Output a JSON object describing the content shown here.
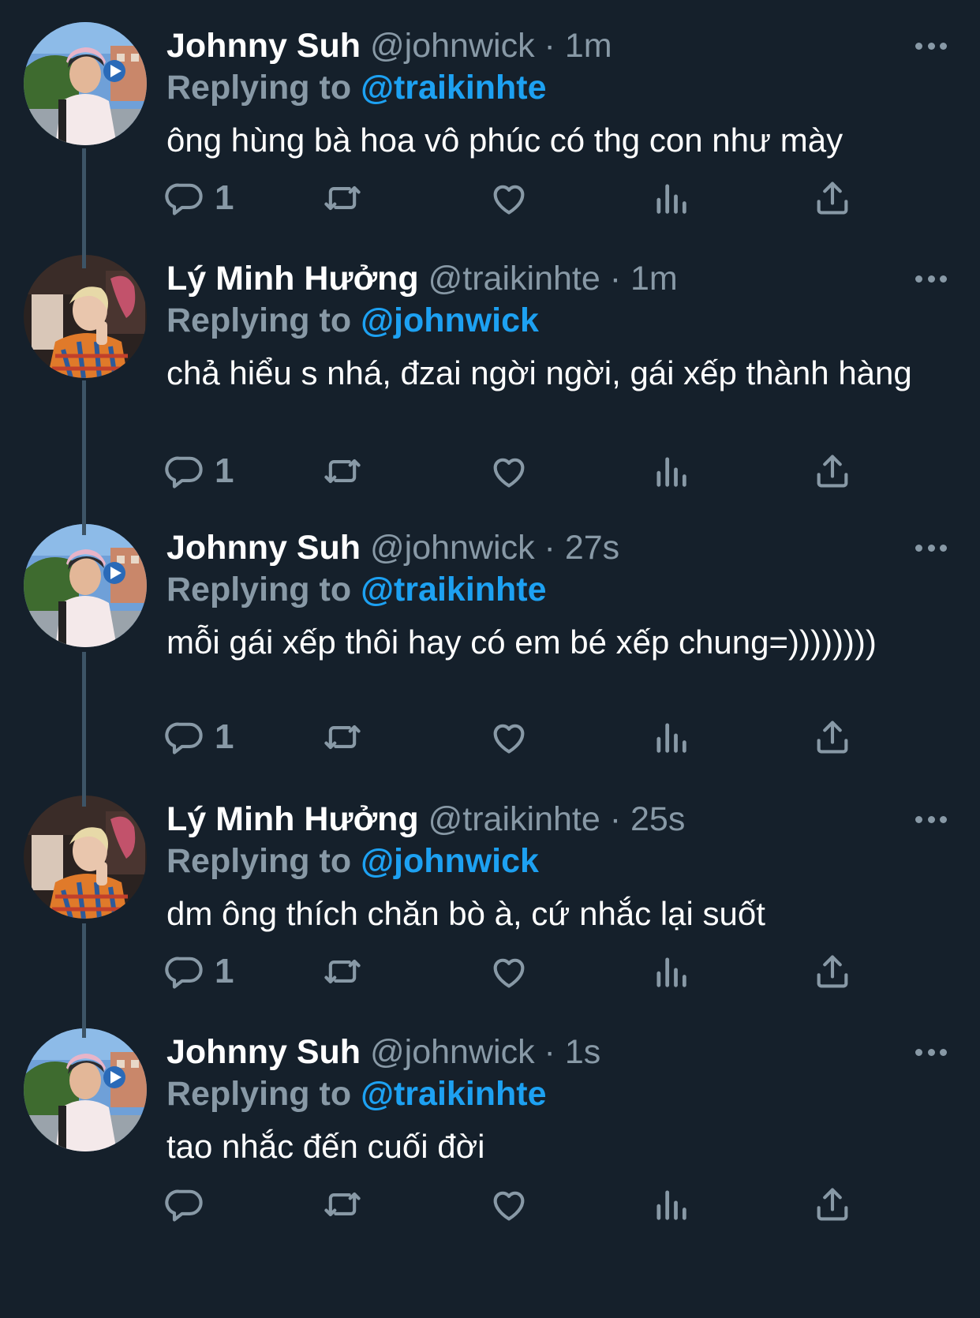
{
  "tweets": [
    {
      "author": "Johnny Suh",
      "handle": "@johnwick",
      "sep": "·",
      "time": "1m",
      "replying_label": "Replying to",
      "replying_to": "@traikinhte",
      "text": "ông hùng bà hoa vô phúc có thg con như mày",
      "reply_count": "1",
      "avatar": "johnny"
    },
    {
      "author": "Lý Minh Hưởng",
      "handle": "@traikinhte",
      "sep": "·",
      "time": "1m",
      "replying_label": "Replying to",
      "replying_to": "@johnwick",
      "text": "chả hiểu s nhá, đzai ngời ngời, gái xếp thành hàng",
      "reply_count": "1",
      "avatar": "ly"
    },
    {
      "author": "Johnny Suh",
      "handle": "@johnwick",
      "sep": "·",
      "time": "27s",
      "replying_label": "Replying to",
      "replying_to": "@traikinhte",
      "text": "mỗi gái xếp thôi hay có em bé xếp chung=))))))))",
      "reply_count": "1",
      "avatar": "johnny"
    },
    {
      "author": "Lý Minh Hưởng",
      "handle": "@traikinhte",
      "sep": "·",
      "time": "25s",
      "replying_label": "Replying to",
      "replying_to": "@johnwick",
      "text": "dm ông thích chăn bò à, cứ nhắc lại suốt",
      "reply_count": "1",
      "avatar": "ly"
    },
    {
      "author": "Johnny Suh",
      "handle": "@johnwick",
      "sep": "·",
      "time": "1s",
      "replying_label": "Replying to",
      "replying_to": "@traikinhte",
      "text": "tao nhắc đến cuối đời",
      "reply_count": "",
      "avatar": "johnny"
    }
  ],
  "icons": {
    "reply": "reply-icon",
    "retweet": "retweet-icon",
    "like": "heart-icon",
    "analytics": "analytics-icon",
    "share": "share-icon",
    "more": "more-icon"
  },
  "colors": {
    "background": "#15202b",
    "text": "#ffffff",
    "secondary": "#8899a6",
    "mention": "#1da1f2",
    "thread_line": "#3d5466"
  }
}
